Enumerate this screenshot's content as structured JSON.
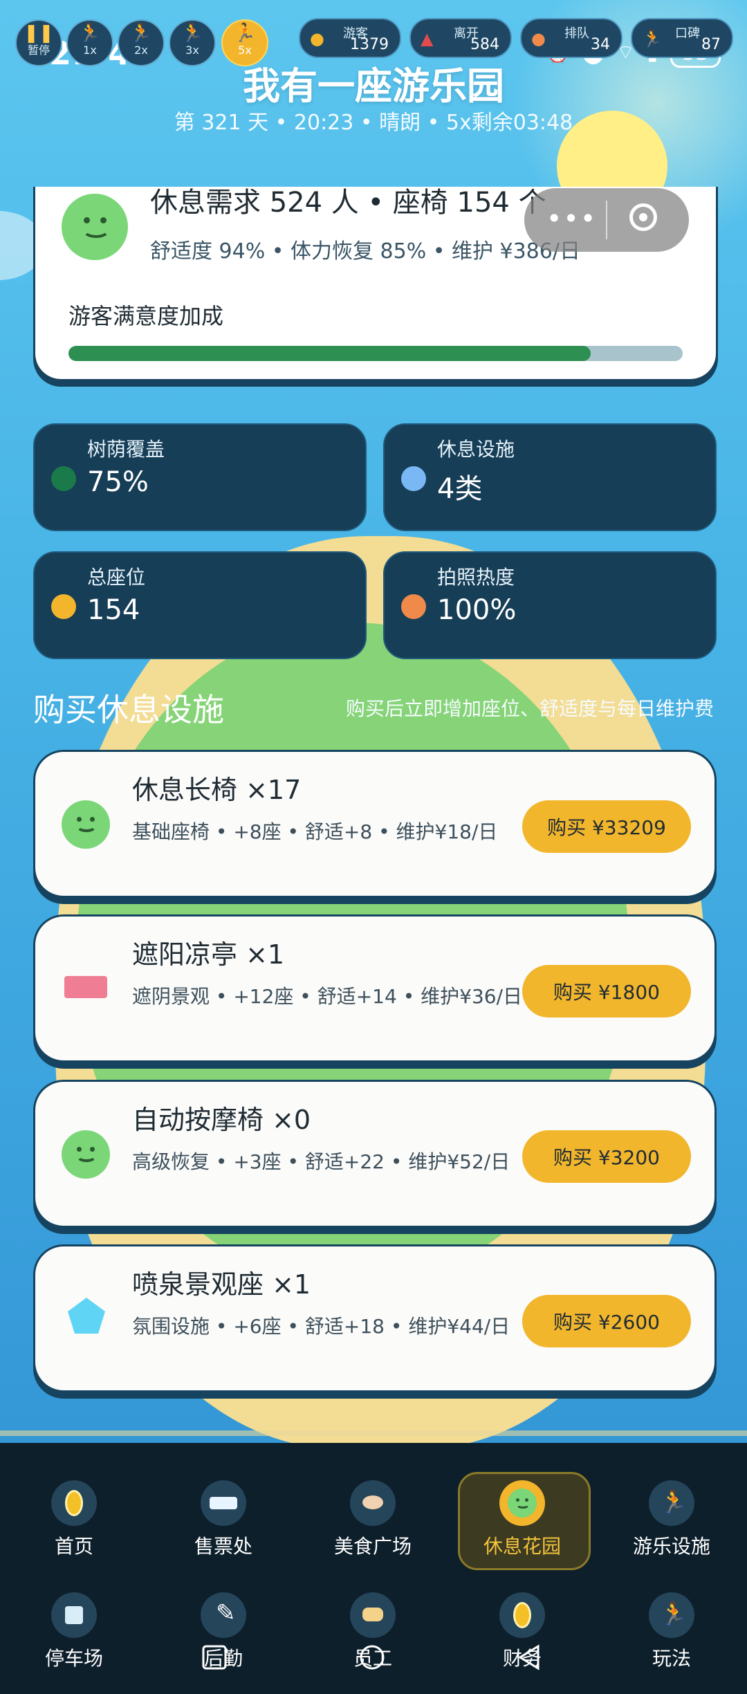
{
  "status_bar": {
    "time": "12:04",
    "battery": "53"
  },
  "speed_buttons": [
    {
      "label": "暂停",
      "active": false
    },
    {
      "label": "1x",
      "active": false
    },
    {
      "label": "2x",
      "active": false
    },
    {
      "label": "3x",
      "active": false
    },
    {
      "label": "5x",
      "active": true
    }
  ],
  "top_stats": [
    {
      "label": "游客",
      "value": "1379",
      "icon": "visitor-icon"
    },
    {
      "label": "离开",
      "value": "584",
      "icon": "warning-icon"
    },
    {
      "label": "排队",
      "value": "34",
      "icon": "queue-icon"
    },
    {
      "label": "口碑",
      "value": "87",
      "icon": "runner-icon"
    }
  ],
  "header": {
    "title": "我有一座游乐园",
    "subtitle": "第 321 天 • 20:23 • 晴朗 • 5x剩余03:48"
  },
  "summary": {
    "headline": "休息需求 524 人 • 座椅 154 个",
    "detail": "舒适度 94% • 体力恢复 85% • 维护 ¥386/日",
    "bonus_label": "游客满意度加成",
    "bonus_fraction": 0.85
  },
  "tiles": [
    {
      "label": "树荫覆盖",
      "value": "75%",
      "color": "#1a7a4a"
    },
    {
      "label": "休息设施",
      "value": "4类",
      "color": "#7ab8f5"
    },
    {
      "label": "总座位",
      "value": "154",
      "color": "#f3b52c"
    },
    {
      "label": "拍照热度",
      "value": "100%",
      "color": "#f08a4b"
    }
  ],
  "section": {
    "title": "购买休息设施",
    "hint": "购买后立即增加座位、舒适度与每日维护费"
  },
  "items": [
    {
      "name": "休息长椅 ×17",
      "desc": "基础座椅 • +8座 • 舒适+8 • 维护¥18/日",
      "buy": "购买 ¥33209",
      "icon": "smiley-icon"
    },
    {
      "name": "遮阳凉亭 ×1",
      "desc": "遮阴景观 • +12座 • 舒适+14 • 维护¥36/日",
      "buy": "购买 ¥1800",
      "icon": "ticket-icon"
    },
    {
      "name": "自动按摩椅 ×0",
      "desc": "高级恢复 • +3座 • 舒适+22 • 维护¥52/日",
      "buy": "购买 ¥3200",
      "icon": "smiley-icon"
    },
    {
      "name": "喷泉景观座 ×1",
      "desc": "氛围设施 • +6座 • 舒适+18 • 维护¥44/日",
      "buy": "购买 ¥2600",
      "icon": "gem-icon"
    }
  ],
  "nav": [
    {
      "label": "首页",
      "icon": "coin-icon"
    },
    {
      "label": "售票处",
      "icon": "ticket-icon"
    },
    {
      "label": "美食广场",
      "icon": "food-icon"
    },
    {
      "label": "休息花园",
      "icon": "smiley-icon",
      "active": true
    },
    {
      "label": "游乐设施",
      "icon": "runner-icon"
    },
    {
      "label": "停车场",
      "icon": "parking-icon"
    },
    {
      "label": "后勤",
      "icon": "wrench-icon"
    },
    {
      "label": "员工",
      "icon": "staff-icon"
    },
    {
      "label": "财务",
      "icon": "coin-icon"
    },
    {
      "label": "玩法",
      "icon": "runner-icon"
    }
  ],
  "colors": {
    "accent": "#f2b62c",
    "card_border": "#16435f",
    "tile_bg": "#173e57",
    "progress": "#2e8f52",
    "nav_bg": "#0d1f2b"
  }
}
